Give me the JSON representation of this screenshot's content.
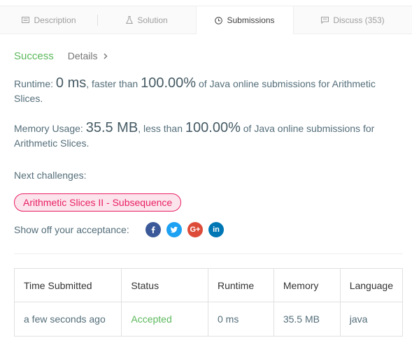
{
  "tabs": [
    {
      "label": "Description",
      "icon": "document-icon"
    },
    {
      "label": "Solution",
      "icon": "flask-icon"
    },
    {
      "label": "Submissions",
      "icon": "clock-icon"
    },
    {
      "label": "Discuss (353)",
      "icon": "comment-icon"
    }
  ],
  "result": {
    "status": "Success",
    "details_label": "Details"
  },
  "runtime": {
    "label": "Runtime: ",
    "value": "0 ms",
    "mid": ", faster than ",
    "percent": "100.00%",
    "suffix": " of Java online submissions for Arithmetic Slices."
  },
  "memory": {
    "label": "Memory Usage: ",
    "value": "35.5 MB",
    "mid": ", less than ",
    "percent": "100.00%",
    "suffix": " of Java online submissions for Arithmetic Slices."
  },
  "next": {
    "label": "Next challenges:",
    "challenge": "Arithmetic Slices II - Subsequence"
  },
  "share": {
    "label": "Show off your acceptance:",
    "icons": [
      "facebook-icon",
      "twitter-icon",
      "google-plus-icon",
      "linkedin-icon"
    ]
  },
  "colors": {
    "success": "#5cb85c",
    "chip": "#e91e63",
    "facebook": "#3b5998",
    "twitter": "#1da1f2",
    "google": "#dd4b39",
    "linkedin": "#0077b5"
  },
  "table": {
    "headers": [
      "Time Submitted",
      "Status",
      "Runtime",
      "Memory",
      "Language"
    ],
    "rows": [
      [
        "a few seconds ago",
        "Accepted",
        "0 ms",
        "35.5 MB",
        "java"
      ]
    ]
  }
}
